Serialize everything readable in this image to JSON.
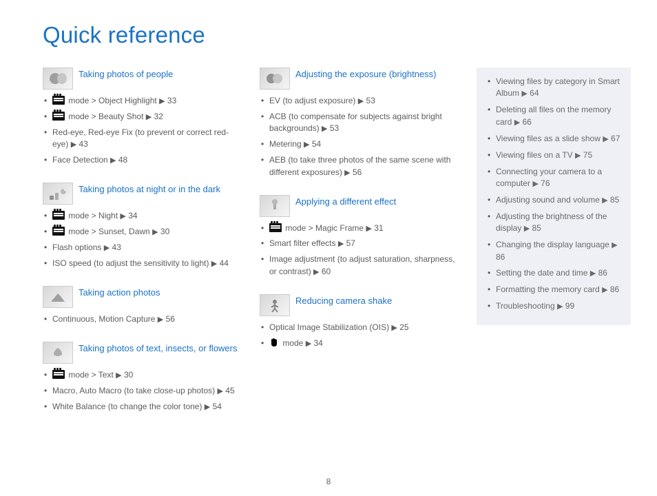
{
  "title": "Quick reference",
  "page_number": "8",
  "arrow": "▶",
  "columns": {
    "left": [
      {
        "title": "Taking photos of people",
        "icon": "face",
        "items": [
          {
            "pre_icon": "mode",
            "text": " mode > Object Highlight ",
            "page": "33"
          },
          {
            "pre_icon": "mode",
            "text": " mode > Beauty Shot ",
            "page": "32"
          },
          {
            "text": "Red-eye, Red-eye Fix (to prevent or correct red-eye) ",
            "page": "43"
          },
          {
            "text": "Face Detection ",
            "page": "48"
          }
        ]
      },
      {
        "title": "Taking photos at night or in the dark",
        "icon": "night",
        "items": [
          {
            "pre_icon": "mode",
            "text": " mode > Night ",
            "page": "34"
          },
          {
            "pre_icon": "mode",
            "text": " mode > Sunset, Dawn ",
            "page": "30"
          },
          {
            "text": "Flash options ",
            "page": "43"
          },
          {
            "text": "ISO speed (to adjust the sensitivity to light) ",
            "page": "44"
          }
        ]
      },
      {
        "title": "Taking action photos",
        "icon": "action",
        "items": [
          {
            "text": "Continuous, Motion Capture ",
            "page": "56"
          }
        ]
      },
      {
        "title": "Taking photos of text, insects, or flowers",
        "icon": "macro",
        "items": [
          {
            "pre_icon": "mode",
            "text": " mode > Text ",
            "page": "30"
          },
          {
            "text": "Macro, Auto Macro (to take close-up photos) ",
            "page": "45"
          },
          {
            "text": "White Balance (to change the color tone) ",
            "page": "54"
          }
        ]
      }
    ],
    "mid": [
      {
        "title": "Adjusting the exposure (brightness)",
        "icon": "exposure",
        "items": [
          {
            "text": "EV (to adjust exposure) ",
            "page": "53"
          },
          {
            "text": "ACB (to compensate for subjects against bright backgrounds) ",
            "page": "53"
          },
          {
            "text": "Metering ",
            "page": "54"
          },
          {
            "text": "AEB (to take three photos of the same scene with different exposures) ",
            "page": "56"
          }
        ]
      },
      {
        "title": "Applying a different effect",
        "icon": "effect",
        "items": [
          {
            "pre_icon": "mode",
            "text": " mode > Magic Frame ",
            "page": "31"
          },
          {
            "text": "Smart filter effects ",
            "page": "57"
          },
          {
            "text": "Image adjustment (to adjust saturation, sharpness, or contrast) ",
            "page": "60"
          }
        ]
      },
      {
        "title": "Reducing camera shake",
        "icon": "shake",
        "items": [
          {
            "text": "Optical Image Stabilization (OIS) ",
            "page": "25"
          },
          {
            "pre_icon": "hand",
            "text": " mode ",
            "page": "34"
          }
        ]
      }
    ],
    "right": [
      {
        "text": "Viewing files by category in Smart Album ",
        "page": "64"
      },
      {
        "text": "Deleting all files on the memory card ",
        "page": "66"
      },
      {
        "text": "Viewing files as a slide show ",
        "page": "67"
      },
      {
        "text": "Viewing files on a TV ",
        "page": "75"
      },
      {
        "text": "Connecting your camera to a computer ",
        "page": "76"
      },
      {
        "text": "Adjusting sound and volume ",
        "page": "85"
      },
      {
        "text": "Adjusting the brightness of the display ",
        "page": "85"
      },
      {
        "text": "Changing the display language ",
        "page": "86"
      },
      {
        "text": "Setting the date and time ",
        "page": "86"
      },
      {
        "text": "Formatting the memory card ",
        "page": "86"
      },
      {
        "text": "Troubleshooting ",
        "page": "99"
      }
    ]
  },
  "icons_svg": {
    "face": "<svg viewBox='0 0 28 22'><circle cx='10' cy='11' r='8' fill='#888'/><ellipse cx='20' cy='11' rx='7' ry='8' fill='#bbb'/></svg>",
    "night": "<svg viewBox='0 0 28 22'><rect x='2' y='14' width='6' height='6' fill='#777'/><rect x='10' y='10' width='5' height='10' fill='#999'/><path d='M22 4 a4 4 0 1 0 4 4 a5 5 0 0 1 -4 -4' fill='#aaa'/></svg>",
    "action": "<svg viewBox='0 0 28 22'><path d='M4 18 L14 6 L18 10 L24 18 Z' fill='#888'/></svg>",
    "macro": "<svg viewBox='0 0 28 22'><path d='M14 4 Q8 8 8 14 Q14 18 20 14 Q20 8 14 4' fill='#999'/></svg>",
    "exposure": "<svg viewBox='0 0 28 22'><circle cx='9' cy='11' r='7' fill='#777'/><circle cx='18' cy='11' r='7' fill='#bbb'/></svg>",
    "effect": "<svg viewBox='0 0 28 22'><rect x='12' y='6' width='4' height='10' fill='#999'/><circle cx='14' cy='5' r='4' fill='#aaa'/></svg>",
    "shake": "<svg viewBox='0 0 28 22'><circle cx='14' cy='6' r='3' fill='#666'/><path d='M14 9 L14 16 M14 11 L9 14 M14 11 L19 14 M14 16 L10 21 M14 16 L18 21' stroke='#666' stroke-width='2' fill='none'/></svg>"
  }
}
